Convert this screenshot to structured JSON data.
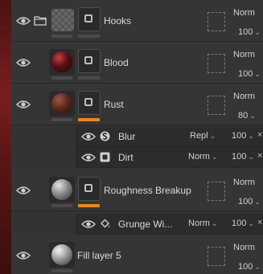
{
  "layers": [
    {
      "name": "Hooks",
      "blend": "Norm",
      "opacity": "100",
      "thumb": "checker",
      "folder": true
    },
    {
      "name": "Blood",
      "blend": "Norm",
      "opacity": "100",
      "thumb": "#5a0d12"
    },
    {
      "name": "Rust",
      "blend": "Norm",
      "opacity": "80",
      "thumb": "#5c2a1e"
    },
    {
      "name": "Roughness Breakup",
      "blend": "Norm",
      "opacity": "100",
      "thumb": "#8a8a8a"
    },
    {
      "name": "Fill layer 5",
      "blend": "Norm",
      "opacity": "100",
      "thumb": "#9a9a9a"
    }
  ],
  "effects": [
    {
      "name": "Blur",
      "blend": "Repl",
      "opacity": "100",
      "icon": "blur-filter-icon"
    },
    {
      "name": "Dirt",
      "blend": "Norm",
      "opacity": "100",
      "icon": "generator-icon"
    },
    {
      "name": "Grunge Wi...",
      "blend": "Norm",
      "opacity": "100",
      "icon": "fill-bucket-icon"
    }
  ],
  "colors": {
    "accent": "#e8871e",
    "panel": "#333333",
    "strip": "#6a1818"
  },
  "close_glyph": "×",
  "chevron_glyph": "⌄"
}
